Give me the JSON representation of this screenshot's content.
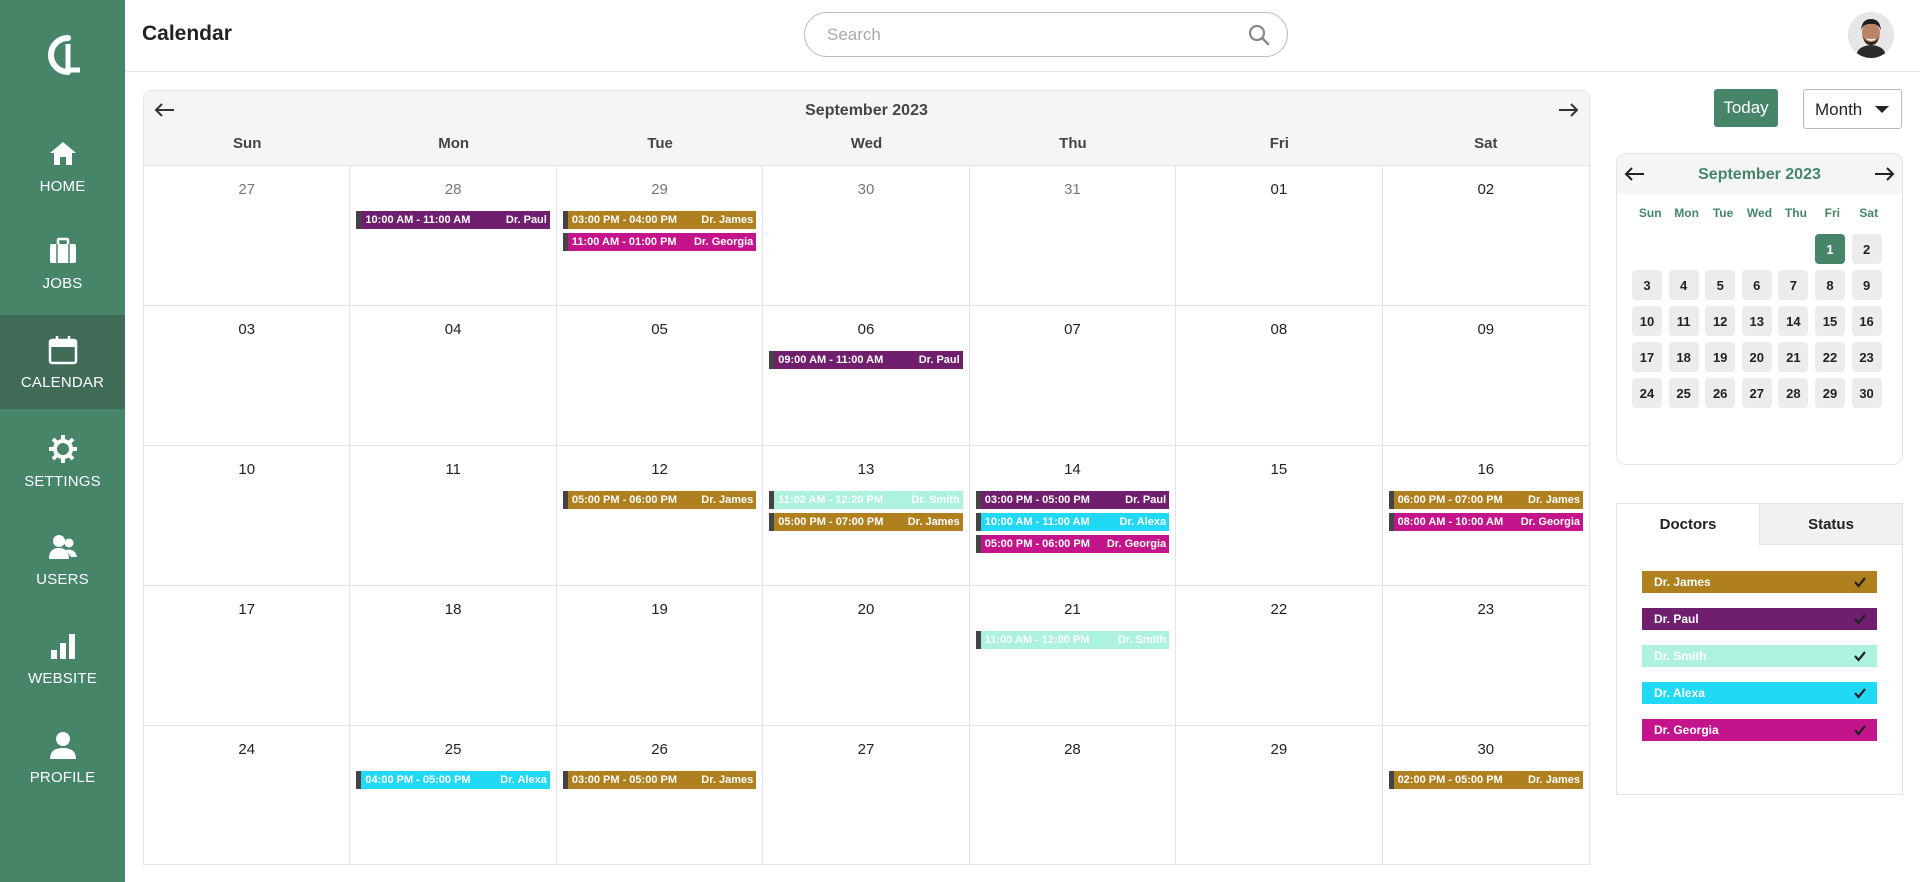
{
  "nav": {
    "items": [
      {
        "label": "HOME",
        "icon": "home-icon"
      },
      {
        "label": "JOBS",
        "icon": "briefcase-icon"
      },
      {
        "label": "CALENDAR",
        "icon": "calendar-icon"
      },
      {
        "label": "SETTINGS",
        "icon": "gear-icon"
      },
      {
        "label": "USERS",
        "icon": "users-icon"
      },
      {
        "label": "WEBSITE",
        "icon": "bar-chart-icon"
      },
      {
        "label": "PROFILE",
        "icon": "user-icon"
      }
    ],
    "active": "CALENDAR"
  },
  "header": {
    "title": "Calendar",
    "search_placeholder": "Search"
  },
  "calendar": {
    "month_label": "September 2023",
    "weekdays": [
      "Sun",
      "Mon",
      "Tue",
      "Wed",
      "Thu",
      "Fri",
      "Sat"
    ],
    "cells": [
      {
        "date": "27",
        "other": true,
        "events": []
      },
      {
        "date": "28",
        "other": true,
        "events": [
          {
            "time": "10:00 AM - 11:00 AM",
            "doctor": "Dr. Paul"
          }
        ]
      },
      {
        "date": "29",
        "other": true,
        "events": [
          {
            "time": "03:00 PM - 04:00 PM",
            "doctor": "Dr. James"
          },
          {
            "time": "11:00 AM - 01:00 PM",
            "doctor": "Dr. Georgia"
          }
        ]
      },
      {
        "date": "30",
        "other": true,
        "events": []
      },
      {
        "date": "31",
        "other": true,
        "events": []
      },
      {
        "date": "01",
        "other": false,
        "events": []
      },
      {
        "date": "02",
        "other": false,
        "events": []
      },
      {
        "date": "03",
        "other": false,
        "events": []
      },
      {
        "date": "04",
        "other": false,
        "events": []
      },
      {
        "date": "05",
        "other": false,
        "events": []
      },
      {
        "date": "06",
        "other": false,
        "events": [
          {
            "time": "09:00 AM - 11:00 AM",
            "doctor": "Dr. Paul"
          }
        ]
      },
      {
        "date": "07",
        "other": false,
        "events": []
      },
      {
        "date": "08",
        "other": false,
        "events": []
      },
      {
        "date": "09",
        "other": false,
        "events": []
      },
      {
        "date": "10",
        "other": false,
        "events": []
      },
      {
        "date": "11",
        "other": false,
        "events": []
      },
      {
        "date": "12",
        "other": false,
        "events": [
          {
            "time": "05:00 PM - 06:00 PM",
            "doctor": "Dr. James"
          }
        ]
      },
      {
        "date": "13",
        "other": false,
        "events": [
          {
            "time": "11:02 AM - 12:20 PM",
            "doctor": "Dr. Smith"
          },
          {
            "time": "05:00 PM - 07:00 PM",
            "doctor": "Dr. James"
          }
        ]
      },
      {
        "date": "14",
        "other": false,
        "events": [
          {
            "time": "03:00 PM - 05:00 PM",
            "doctor": "Dr. Paul"
          },
          {
            "time": "10:00 AM - 11:00 AM",
            "doctor": "Dr. Alexa"
          },
          {
            "time": "05:00 PM - 06:00 PM",
            "doctor": "Dr. Georgia"
          }
        ]
      },
      {
        "date": "15",
        "other": false,
        "events": []
      },
      {
        "date": "16",
        "other": false,
        "events": [
          {
            "time": "06:00 PM - 07:00 PM",
            "doctor": "Dr. James"
          },
          {
            "time": "08:00 AM - 10:00 AM",
            "doctor": "Dr. Georgia"
          }
        ]
      },
      {
        "date": "17",
        "other": false,
        "events": []
      },
      {
        "date": "18",
        "other": false,
        "events": []
      },
      {
        "date": "19",
        "other": false,
        "events": []
      },
      {
        "date": "20",
        "other": false,
        "events": []
      },
      {
        "date": "21",
        "other": false,
        "events": [
          {
            "time": "11:00 AM - 12:00 PM",
            "doctor": "Dr. Smith"
          }
        ]
      },
      {
        "date": "22",
        "other": false,
        "events": []
      },
      {
        "date": "23",
        "other": false,
        "events": []
      },
      {
        "date": "24",
        "other": false,
        "events": []
      },
      {
        "date": "25",
        "other": false,
        "events": [
          {
            "time": "04:00 PM - 05:00 PM",
            "doctor": "Dr. Alexa"
          }
        ]
      },
      {
        "date": "26",
        "other": false,
        "events": [
          {
            "time": "03:00 PM - 05:00 PM",
            "doctor": "Dr. James"
          }
        ]
      },
      {
        "date": "27",
        "other": false,
        "events": []
      },
      {
        "date": "28",
        "other": false,
        "events": []
      },
      {
        "date": "29",
        "other": false,
        "events": []
      },
      {
        "date": "30",
        "other": false,
        "events": [
          {
            "time": "02:00 PM - 05:00 PM",
            "doctor": "Dr. James"
          }
        ]
      }
    ]
  },
  "controls": {
    "today_label": "Today",
    "view_label": "Month"
  },
  "mini_calendar": {
    "month_label": "September 2023",
    "weekdays": [
      "Sun",
      "Mon",
      "Tue",
      "Wed",
      "Thu",
      "Fri",
      "Sat"
    ],
    "leading_blanks": 5,
    "days": [
      "1",
      "2",
      "3",
      "4",
      "5",
      "6",
      "7",
      "8",
      "9",
      "10",
      "11",
      "12",
      "13",
      "14",
      "15",
      "16",
      "17",
      "18",
      "19",
      "20",
      "21",
      "22",
      "23",
      "24",
      "25",
      "26",
      "27",
      "28",
      "29",
      "30"
    ],
    "selected": "1"
  },
  "filter": {
    "tabs": [
      "Doctors",
      "Status"
    ],
    "active_tab": "Doctors",
    "doctors": [
      {
        "name": "Dr. James",
        "checked": true
      },
      {
        "name": "Dr. Paul",
        "checked": true
      },
      {
        "name": "Dr. Smith",
        "checked": true
      },
      {
        "name": "Dr. Alexa",
        "checked": true
      },
      {
        "name": "Dr. Georgia",
        "checked": true
      }
    ]
  },
  "colors": {
    "accent": "#468568",
    "sidebar_active": "#3f6b57",
    "Dr. James": "#b0801f",
    "Dr. Paul": "#6f1f6e",
    "Dr. Smith": "#adf2df",
    "Dr. Alexa": "#22d9f5",
    "Dr. Georgia": "#c4148c"
  }
}
